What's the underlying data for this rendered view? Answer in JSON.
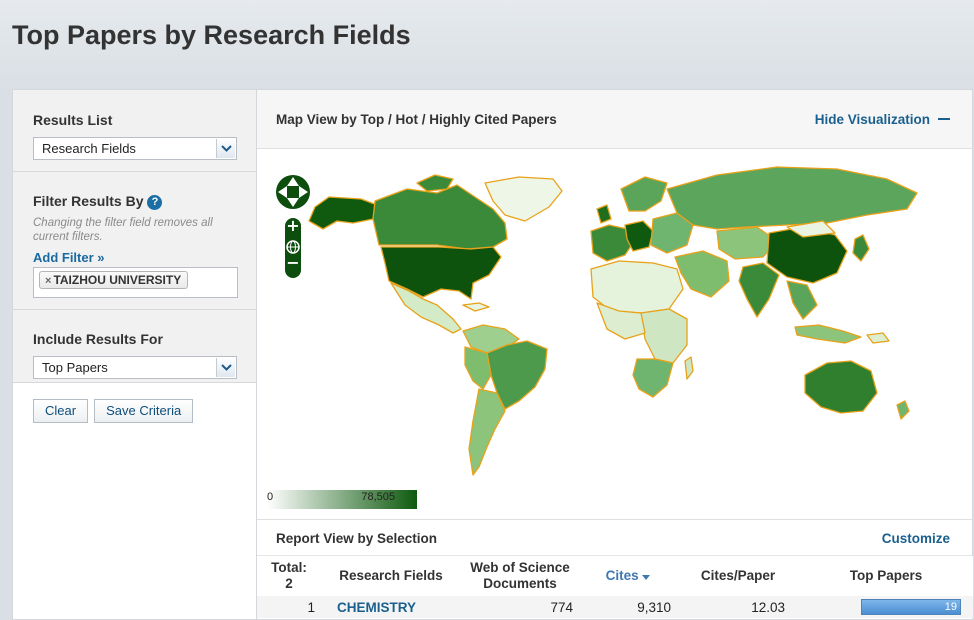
{
  "page": {
    "title": "Top Papers by Research Fields"
  },
  "sidebar": {
    "results_list": {
      "label": "Results List",
      "selected": "Research Fields"
    },
    "filter": {
      "label": "Filter Results By",
      "help_icon": "question-mark-icon",
      "hint": "Changing the filter field removes all current filters.",
      "add_filter": "Add Filter »",
      "chip_remove": "×",
      "chip_label": "TAIZHOU UNIVERSITY"
    },
    "include": {
      "label": "Include Results For",
      "selected": "Top Papers"
    },
    "buttons": {
      "clear": "Clear",
      "save": "Save Criteria"
    }
  },
  "map": {
    "title": "Map View by Top / Hot / Highly Cited Papers",
    "hide_label": "Hide Visualization",
    "legend_min": "0",
    "legend_max": "78,505",
    "colors": {
      "low": "#ffffff",
      "high": "#0e5a0e",
      "border": "#e8a21a"
    }
  },
  "report": {
    "title": "Report View by Selection",
    "customize": "Customize",
    "columns": {
      "total": "Total:",
      "total_count": "2",
      "field": "Research Fields",
      "docs": "Web of Science Documents",
      "cites": "Cites",
      "cites_per_paper": "Cites/Paper",
      "top_papers": "Top Papers"
    },
    "rows": [
      {
        "rank": "1",
        "field": "CHEMISTRY",
        "docs": "774",
        "cites": "9,310",
        "cites_per_paper": "12.03",
        "top_papers": "19"
      }
    ]
  }
}
